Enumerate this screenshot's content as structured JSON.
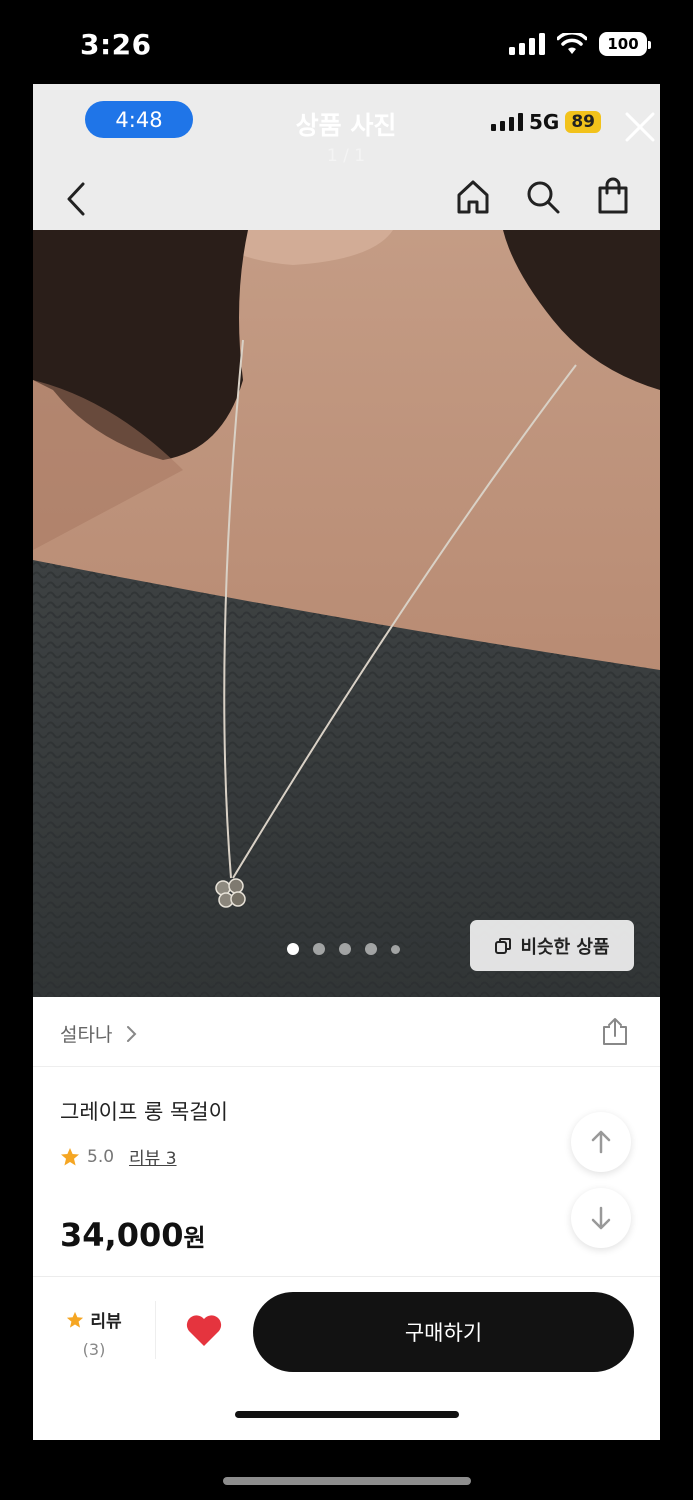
{
  "outer_status": {
    "time": "3:26",
    "battery": "100"
  },
  "inner_status": {
    "call_time": "4:48",
    "title": "상품 사진",
    "page_indicator": "1 / 1",
    "network": "5G",
    "battery": "89"
  },
  "gallery": {
    "dot_count": 5,
    "active_dot": 1,
    "similar_label": "비슷한 상품"
  },
  "product": {
    "brand": "설타나",
    "name": "그레이프 롱 목걸이",
    "rating": "5.0",
    "review_link": "리뷰 3",
    "price": "34,000",
    "currency": "원"
  },
  "bottom_bar": {
    "review_label": "리뷰",
    "review_count": "(3)",
    "buy_label": "구매하기"
  },
  "colors": {
    "accent_blue": "#1f75e8",
    "heart_red": "#e5343e",
    "star": "#f5a623",
    "buy_button": "#121212"
  }
}
